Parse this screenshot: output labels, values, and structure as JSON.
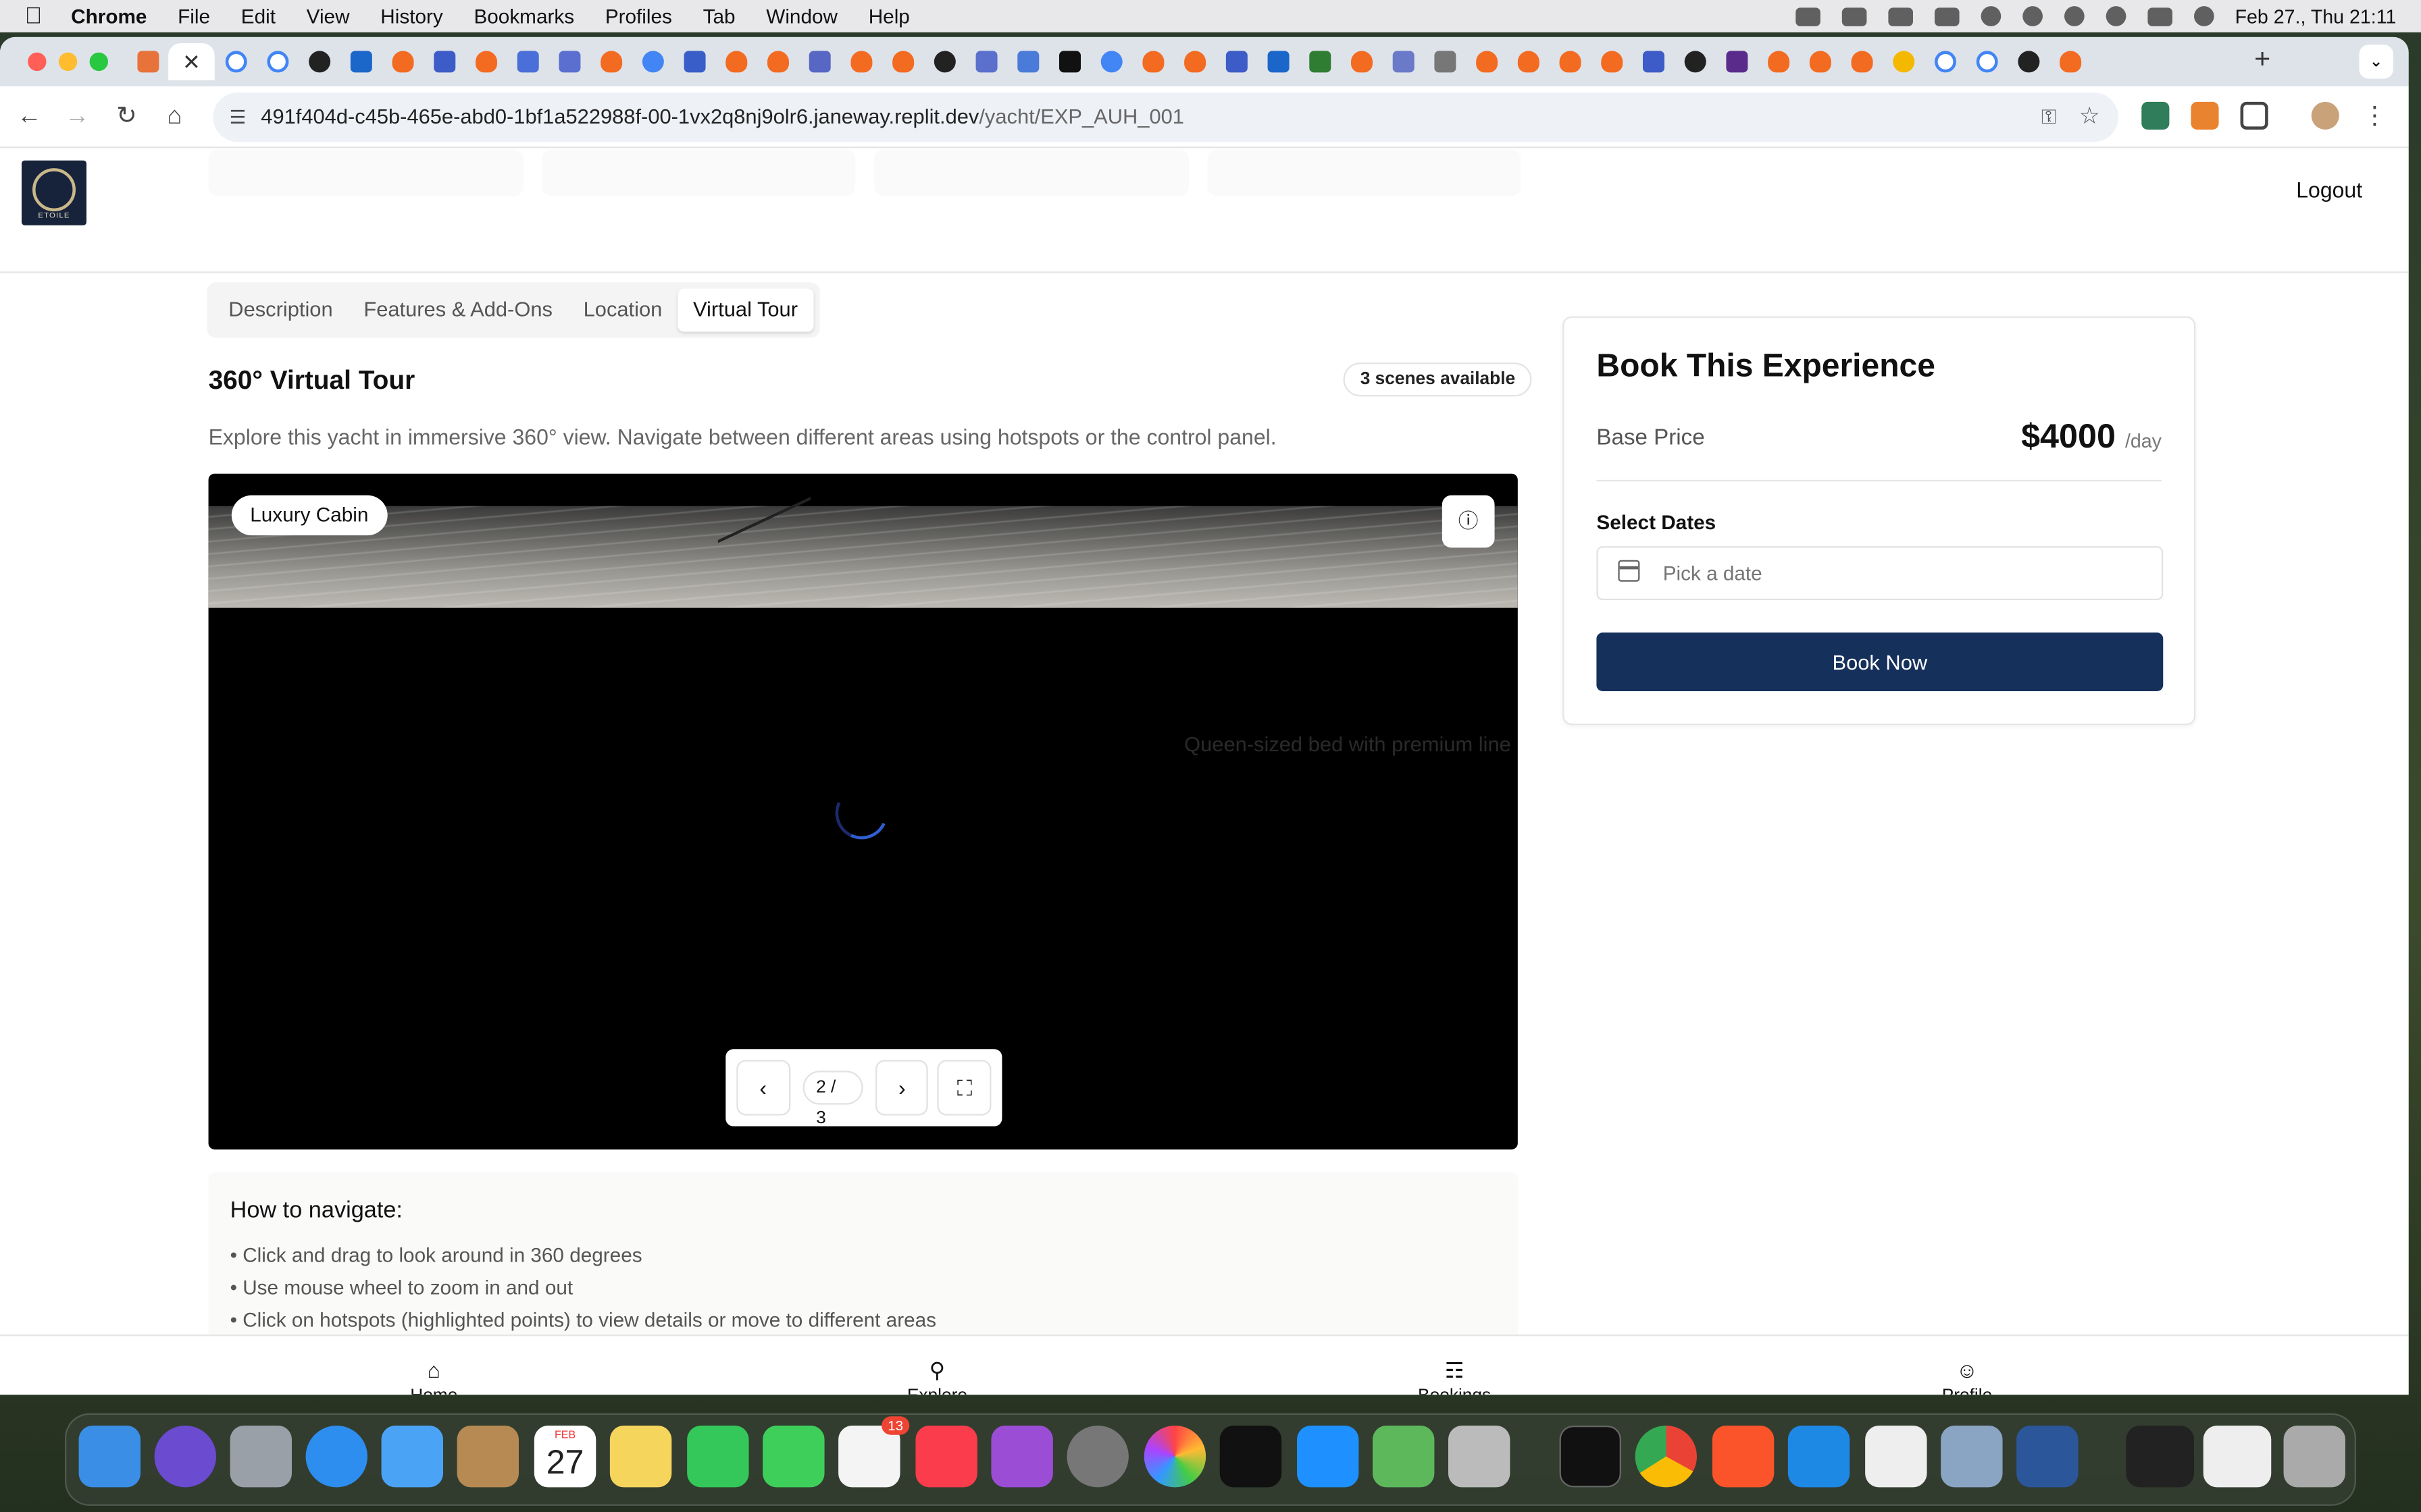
{
  "menubar": {
    "app": "Chrome",
    "items": [
      "File",
      "Edit",
      "View",
      "History",
      "Bookmarks",
      "Profiles",
      "Tab",
      "Window",
      "Help"
    ],
    "clock": "Feb 27., Thu  21:11"
  },
  "browser": {
    "url_host": "491f404d-c45b-465e-abd0-1bf1a522988f-00-1vx2q8nj9olr6.janeway.replit.dev",
    "url_path": "/yacht/EXP_AUH_001"
  },
  "header": {
    "logo_text": "ETOILE",
    "logout_label": "Logout"
  },
  "tabs": [
    {
      "label": "Description"
    },
    {
      "label": "Features & Add-Ons"
    },
    {
      "label": "Location"
    },
    {
      "label": "Virtual Tour"
    }
  ],
  "virtual_tour": {
    "title": "360° Virtual Tour",
    "scenes_badge": "3 scenes available",
    "description": "Explore this yacht in immersive 360° view. Navigate between different areas using hotspots or the control panel.",
    "scene_name": "Luxury Cabin",
    "hotspot_text": "Queen-sized bed with premium line",
    "page_indicator": "2 / 3"
  },
  "help": {
    "title": "How to navigate:",
    "items": [
      "• Click and drag to look around in 360 degrees",
      "• Use mouse wheel to zoom in and out",
      "• Click on hotspots (highlighted points) to view details or move to different areas"
    ]
  },
  "booking": {
    "title": "Book This Experience",
    "base_price_label": "Base Price",
    "price": "$4000",
    "per": "/day",
    "select_dates_label": "Select Dates",
    "date_placeholder": "Pick a date",
    "book_button": "Book Now"
  },
  "bottom_nav": [
    {
      "label": "Home",
      "icon": "home-icon"
    },
    {
      "label": "Explore",
      "icon": "search-icon"
    },
    {
      "label": "Bookings",
      "icon": "book-icon"
    },
    {
      "label": "Profile",
      "icon": "user-icon"
    }
  ],
  "dock": {
    "calendar_month": "FEB",
    "calendar_day": "27",
    "reminders_badge": "13"
  },
  "colors": {
    "primary": "#15305a",
    "accent_spinner": "#2f5fd0"
  }
}
